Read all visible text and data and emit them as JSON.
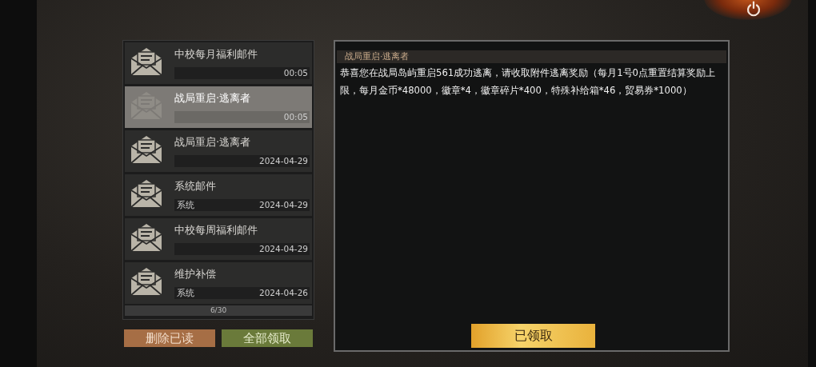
{
  "mails": [
    {
      "title": "中校每月福利邮件",
      "time": "00:05",
      "selected": false
    },
    {
      "title": "战局重启·逃离者",
      "time": "00:05",
      "selected": true
    },
    {
      "title": "战局重启·逃离者",
      "time": "2024-04-29",
      "selected": false
    },
    {
      "title": "系统邮件",
      "sender": "系统",
      "time": "2024-04-29",
      "selected": false
    },
    {
      "title": "中校每周福利邮件",
      "time": "2024-04-29",
      "selected": false
    },
    {
      "title": "维护补偿",
      "sender": "系统",
      "time": "2024-04-26",
      "selected": false
    }
  ],
  "pager": "6/30",
  "list_buttons": [
    {
      "label": "删除已读",
      "kind": "delete"
    },
    {
      "label": "全部领取",
      "kind": "claim"
    }
  ],
  "detail": {
    "title": "战局重启·逃离者",
    "body": "恭喜您在战局岛屿重启561成功逃离，请收取附件逃离奖励（每月1号0点重置结算奖励上限，每月金币*48000，徽章*4，徽章碎片*400，特殊补给箱*46，贸易券*1000）",
    "claim_button": "已领取"
  }
}
